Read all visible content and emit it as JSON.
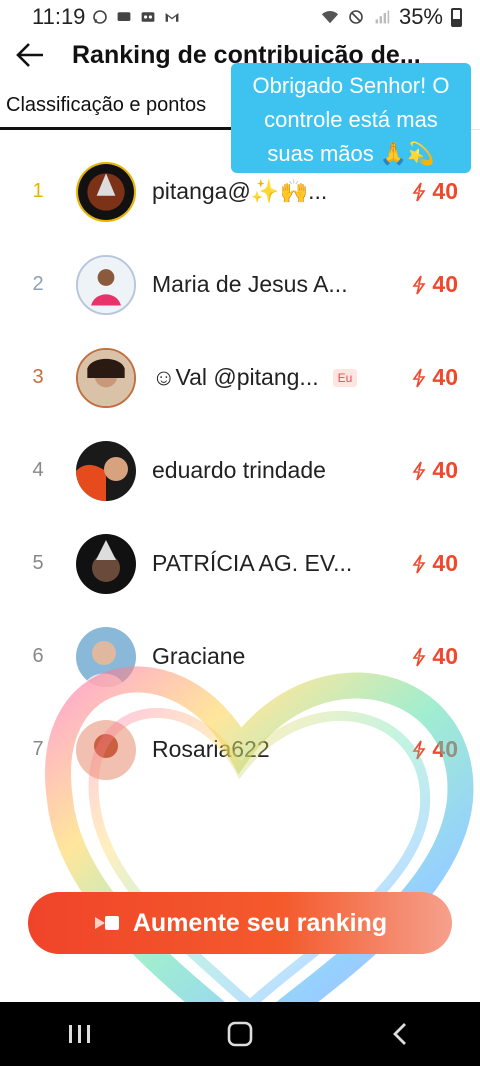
{
  "status_bar": {
    "time": "11:19",
    "battery": "35%",
    "icons": [
      "whatsapp-icon",
      "message-icon",
      "voicemail-icon",
      "gmail-icon",
      "wifi-icon",
      "do-not-disturb-icon",
      "signal-icon",
      "battery-icon"
    ]
  },
  "header": {
    "title": "Ranking de contribuição de...",
    "back_icon": "arrow-left-icon"
  },
  "tabs": [
    {
      "label": "Classificação e pontos",
      "active": true
    }
  ],
  "tooltip": {
    "text": "Obrigado Senhor! O controle está mas suas mãos 🙏💫"
  },
  "ranking": [
    {
      "rank": "1",
      "name": "pitanga@✨🙌...",
      "points": "40",
      "rank_color": "#e8b400"
    },
    {
      "rank": "2",
      "name": "Maria de Jesus A...",
      "points": "40",
      "rank_color": "#8fa0b8"
    },
    {
      "rank": "3",
      "name": "☺Val @pitang...",
      "points": "40",
      "badge": "Eu",
      "rank_color": "#c07040"
    },
    {
      "rank": "4",
      "name": "eduardo trindade",
      "points": "40",
      "rank_color": "#888888"
    },
    {
      "rank": "5",
      "name": "PATRÍCIA AG. EV...",
      "points": "40",
      "rank_color": "#888888"
    },
    {
      "rank": "6",
      "name": "Graciane",
      "points": "40",
      "rank_color": "#888888"
    },
    {
      "rank": "7",
      "name": "Rosaria622",
      "points": "40",
      "rank_color": "#888888"
    }
  ],
  "cta": {
    "label": "Aumente seu ranking",
    "icon": "video-icon"
  },
  "nav": {
    "icons": [
      "recents-icon",
      "home-icon",
      "back-icon"
    ]
  },
  "colors": {
    "accent": "#f0482c",
    "tooltip_bg": "#3ec3f0",
    "nav_bg": "#000000"
  }
}
